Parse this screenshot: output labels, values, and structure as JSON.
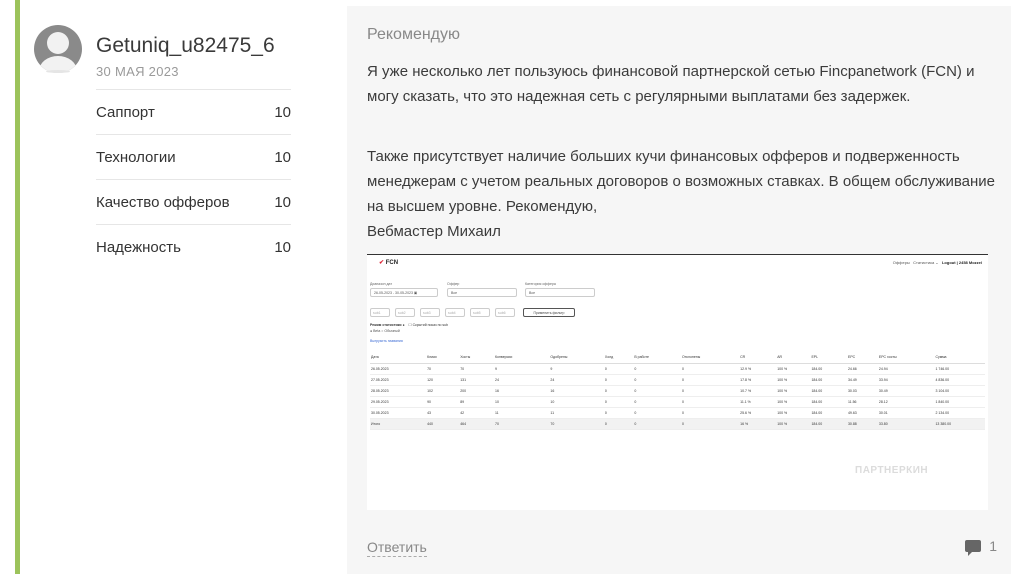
{
  "user": {
    "name": "Getuniq_u82475_6",
    "date": "30 МАЯ 2023"
  },
  "ratings": [
    {
      "label": "Саппорт",
      "value": "10"
    },
    {
      "label": "Технологии",
      "value": "10"
    },
    {
      "label": "Качество офферов",
      "value": "10"
    },
    {
      "label": "Надежность",
      "value": "10"
    }
  ],
  "review": {
    "title": "Рекомендую",
    "p1": "Я уже несколько лет пользуюсь финансовой партнерской сетью Fincpanetwork (FCN) и могу сказать, что это надежная сеть с регулярными выплатами без задержек.",
    "p2": "Также присутствует наличие больших кучи финансовых офферов и подверженность менеджерам с учетом реальных договоров о возможных ставках. В общем обслуживание на высшем уровне. Рекомендую,",
    "p2_sign": "Вебмастер Михаил"
  },
  "screenshot": {
    "logo": "FCN",
    "nav": [
      "Офферы",
      "Статистика ⌄",
      "Logout | 2458 Mozzel"
    ],
    "filter_labels": [
      "Диапазон дат",
      "Оффер",
      "Категория оффера"
    ],
    "date_range": "26-05-2023 - 30-05-2023",
    "offer_value": "Все",
    "category_value": "Все",
    "subs": [
      "sub1",
      "sub2",
      "sub3",
      "sub4",
      "sub5",
      "sub6"
    ],
    "apply_label": "Применить фильтр",
    "mode_label": "Режим статистики",
    "mode_options": "● Beta ○ Обычный",
    "group_label": "☐ Скрытий показ по sub",
    "download": "Выгрузить названия",
    "columns": [
      "Дата",
      "Клики",
      "Хосты",
      "Конверсии",
      "Одобрены",
      "Холд",
      "В работе",
      "Отклонены",
      "CR",
      "AR",
      "EPL",
      "EPC",
      "EPC хосты",
      "Сумма"
    ],
    "rows": [
      [
        "26.05.2023",
        "70",
        "70",
        "9",
        "9",
        "0",
        "0",
        "0",
        "12.9 %",
        "100 %",
        "184.00",
        "24.66",
        "24.94",
        "1 746.00"
      ],
      [
        "27.05.2023",
        "120",
        "131",
        "24",
        "24",
        "0",
        "0",
        "0",
        "17.8 %",
        "100 %",
        "184.00",
        "34.49",
        "33.94",
        "4 836.00"
      ],
      [
        "28.05.2023",
        "102",
        "200",
        "16",
        "16",
        "0",
        "0",
        "0",
        "10.7 %",
        "100 %",
        "184.00",
        "30.03",
        "30.49",
        "3 104.00"
      ],
      [
        "29.05.2023",
        "90",
        "89",
        "10",
        "10",
        "0",
        "0",
        "0",
        "11.1 %",
        "100 %",
        "184.00",
        "11.56",
        "28.12",
        "1 840.00"
      ],
      [
        "30.05.2023",
        "43",
        "42",
        "11",
        "11",
        "0",
        "0",
        "0",
        "25.6 %",
        "100 %",
        "184.00",
        "49.63",
        "30.01",
        "2 134.00"
      ]
    ],
    "total": [
      "Итого",
      "440",
      "464",
      "70",
      "70",
      "0",
      "0",
      "0",
      "16 %",
      "100 %",
      "184.00",
      "30.88",
      "33.80",
      "13 380.00"
    ],
    "watermark": "ПАРТНЕРКИН"
  },
  "actions": {
    "reply": "Ответить",
    "comments_count": "1"
  }
}
